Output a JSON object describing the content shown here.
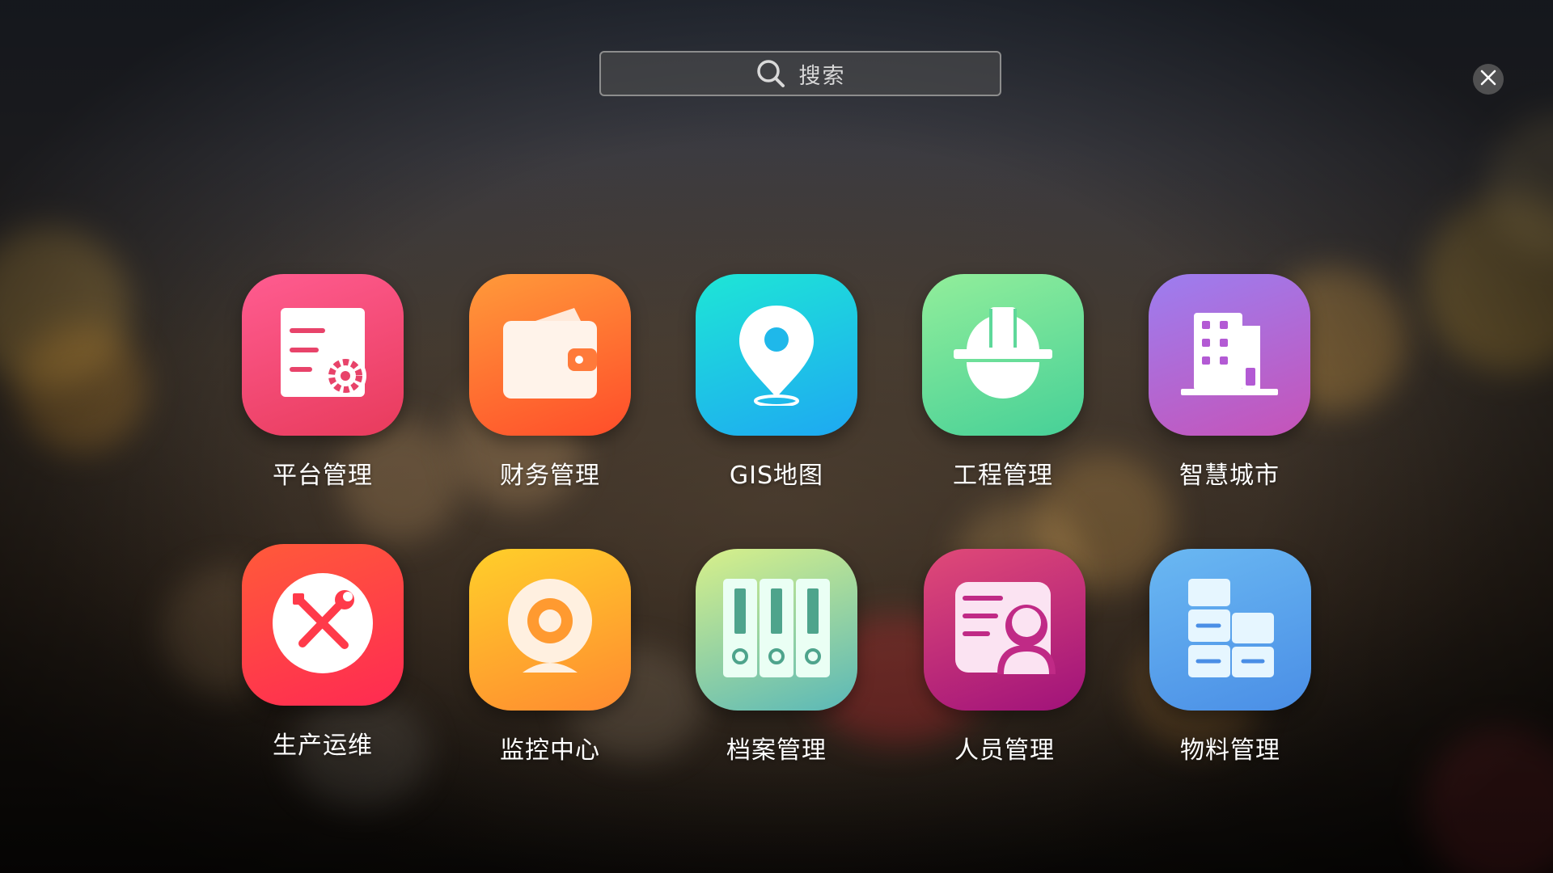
{
  "search": {
    "placeholder": "搜索"
  },
  "apps": [
    {
      "label": "平台管理",
      "icon": "settings-document-icon",
      "color": "#f04a74"
    },
    {
      "label": "财务管理",
      "icon": "wallet-icon",
      "color": "#ff6e2e"
    },
    {
      "label": "GIS地图",
      "icon": "map-pin-icon",
      "color": "#1fc8f0"
    },
    {
      "label": "工程管理",
      "icon": "hard-hat-icon",
      "color": "#5ed89a"
    },
    {
      "label": "智慧城市",
      "icon": "building-icon",
      "color": "#b75ed6"
    },
    {
      "label": "生产运维",
      "icon": "tools-icon",
      "color": "#ff3a4a"
    },
    {
      "label": "监控中心",
      "icon": "webcam-icon",
      "color": "#ffa82a"
    },
    {
      "label": "档案管理",
      "icon": "binders-icon",
      "color": "#8fd8a8"
    },
    {
      "label": "人员管理",
      "icon": "person-card-icon",
      "color": "#c02a86"
    },
    {
      "label": "物料管理",
      "icon": "boxes-icon",
      "color": "#5aa2ee"
    }
  ]
}
